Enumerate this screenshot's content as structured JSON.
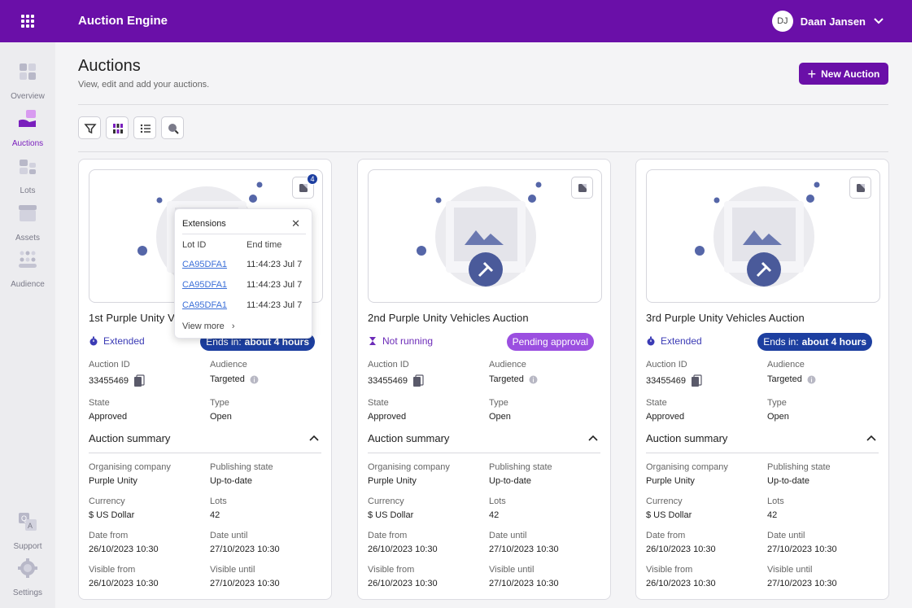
{
  "app": {
    "title": "Auction Engine"
  },
  "user": {
    "initials": "DJ",
    "name": "Daan Jansen"
  },
  "sidebar": {
    "items": [
      {
        "label": "Overview",
        "icon": "overview-icon"
      },
      {
        "label": "Auctions",
        "icon": "auctions-icon",
        "active": true
      },
      {
        "label": "Lots",
        "icon": "lots-icon"
      },
      {
        "label": "Assets",
        "icon": "assets-icon"
      },
      {
        "label": "Audience",
        "icon": "audience-icon"
      },
      {
        "label": "Support",
        "icon": "support-icon"
      },
      {
        "label": "Settings",
        "icon": "settings-icon"
      }
    ]
  },
  "page": {
    "title": "Auctions",
    "subtitle": "View, edit and add your auctions.",
    "new_button": "New Auction"
  },
  "toolbar": [
    "filter-icon",
    "columns-icon",
    "list-icon",
    "search-icon"
  ],
  "labels": {
    "auction_id": "Auction ID",
    "audience": "Audience",
    "state": "State",
    "type": "Type",
    "summary": "Auction summary",
    "organising_company": "Organising company",
    "publishing_state": "Publishing state",
    "currency": "Currency",
    "lots": "Lots",
    "date_from": "Date from",
    "date_until": "Date until",
    "visible_from": "Visible from",
    "visible_until": "Visible until",
    "ends_in": "Ends in:"
  },
  "cards": [
    {
      "title": "1st Purple Unity V",
      "status": "Extended",
      "pill_value": "about 4 hours",
      "extension_count": "4",
      "auction_id": "33455469",
      "audience": "Targeted",
      "state": "Approved",
      "type": "Open",
      "organising_company": "Purple Unity",
      "publishing_state": "Up-to-date",
      "currency": "$ US Dollar",
      "lots": "42",
      "date_from": "26/10/2023 10:30",
      "date_until": "27/10/2023 10:30",
      "visible_from": "26/10/2023 10:30",
      "visible_until": "27/10/2023 10:30"
    },
    {
      "title": "2nd Purple Unity Vehicles Auction",
      "status": "Not running",
      "pill": "Pending approval",
      "auction_id": "33455469",
      "audience": "Targeted",
      "state": "Approved",
      "type": "Open",
      "organising_company": "Purple Unity",
      "publishing_state": "Up-to-date",
      "currency": "$ US Dollar",
      "lots": "42",
      "date_from": "26/10/2023 10:30",
      "date_until": "27/10/2023 10:30",
      "visible_from": "26/10/2023 10:30",
      "visible_until": "27/10/2023 10:30"
    },
    {
      "title": "3rd Purple Unity Vehicles Auction",
      "status": "Extended",
      "pill_value": "about 4 hours",
      "auction_id": "33455469",
      "audience": "Targeted",
      "state": "Approved",
      "type": "Open",
      "organising_company": "Purple Unity",
      "publishing_state": "Up-to-date",
      "currency": "$ US Dollar",
      "lots": "42",
      "date_from": "26/10/2023 10:30",
      "date_until": "27/10/2023 10:30",
      "visible_from": "26/10/2023 10:30",
      "visible_until": "27/10/2023 10:30"
    }
  ],
  "popover": {
    "title": "Extensions",
    "col_lot": "Lot ID",
    "col_time": "End time",
    "rows": [
      {
        "lot": "CA95DFA1",
        "time": "11:44:23 Jul 7"
      },
      {
        "lot": "CA95DFA1",
        "time": "11:44:23 Jul 7"
      },
      {
        "lot": "CA95DFA1",
        "time": "11:44:23 Jul 7"
      }
    ],
    "view_more": "View more"
  },
  "colors": {
    "brand": "#6a0fa8",
    "ends_pill": "#1d3fa0",
    "pending_pill": "#9b4fe0",
    "link": "#3b6fd8"
  }
}
